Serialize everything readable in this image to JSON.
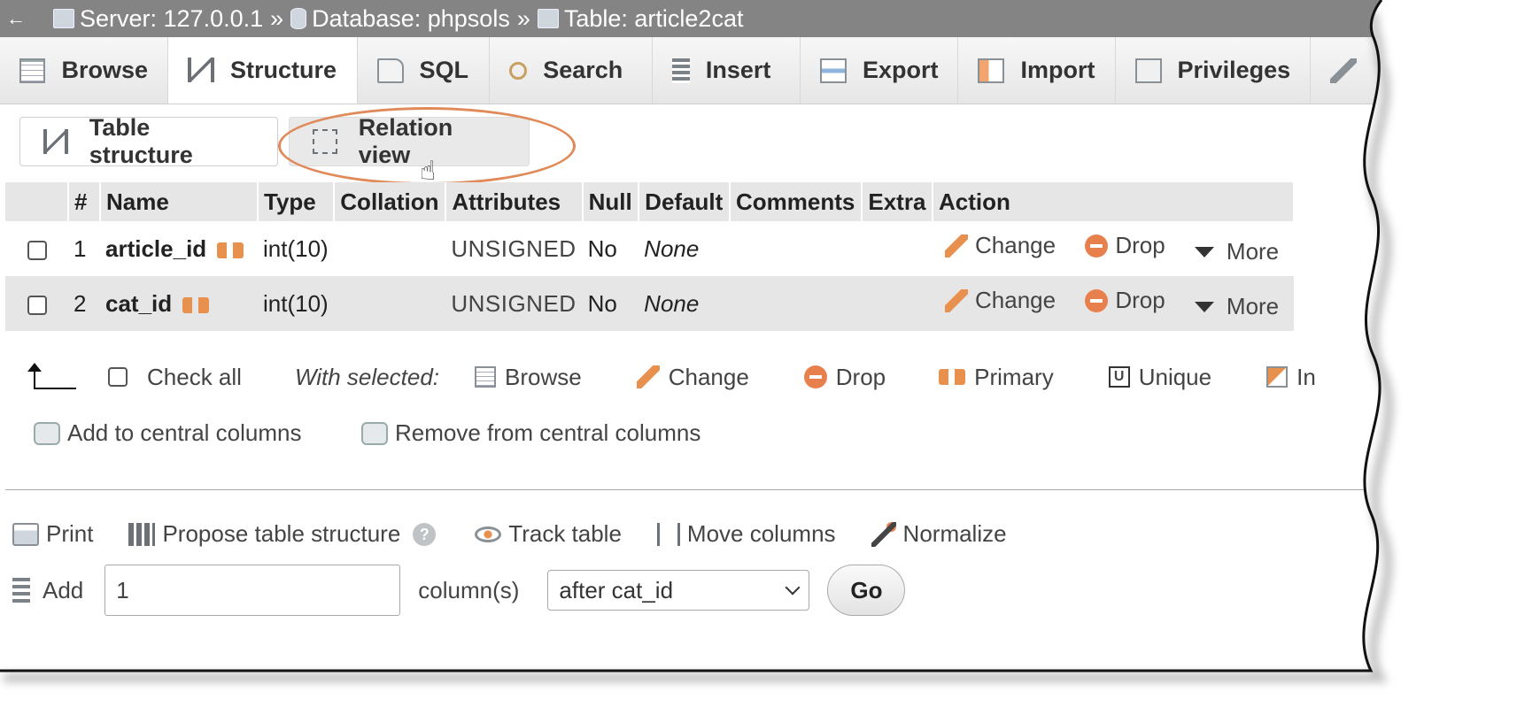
{
  "breadcrumb": {
    "back_glyph": "←",
    "server": "Server: 127.0.0.1",
    "database": "Database: phpsols",
    "table": "Table: article2cat",
    "separator": "»"
  },
  "tabs": [
    {
      "label": "Browse",
      "icon": "browse-icon"
    },
    {
      "label": "Structure",
      "icon": "structure-icon",
      "active": true
    },
    {
      "label": "SQL",
      "icon": "sql-icon"
    },
    {
      "label": "Search",
      "icon": "search-icon"
    },
    {
      "label": "Insert",
      "icon": "insert-icon"
    },
    {
      "label": "Export",
      "icon": "export-icon"
    },
    {
      "label": "Import",
      "icon": "import-icon"
    },
    {
      "label": "Privileges",
      "icon": "privileges-icon"
    }
  ],
  "subtabs": {
    "table_structure": "Table structure",
    "relation_view": "Relation view"
  },
  "table": {
    "headers": [
      "#",
      "Name",
      "Type",
      "Collation",
      "Attributes",
      "Null",
      "Default",
      "Comments",
      "Extra",
      "Action"
    ],
    "rows": [
      {
        "num": "1",
        "name": "article_id",
        "type": "int(10)",
        "attributes": "UNSIGNED",
        "null": "No",
        "default": "None"
      },
      {
        "num": "2",
        "name": "cat_id",
        "type": "int(10)",
        "attributes": "UNSIGNED",
        "null": "No",
        "default": "None"
      }
    ],
    "actions": {
      "change": "Change",
      "drop": "Drop",
      "more": "More"
    }
  },
  "bulk": {
    "check_all": "Check all",
    "with_selected": "With selected:",
    "browse": "Browse",
    "change": "Change",
    "drop": "Drop",
    "primary": "Primary",
    "unique": "Unique",
    "index_partial": "In",
    "add_central": "Add to central columns",
    "remove_central": "Remove from central columns"
  },
  "links": {
    "print": "Print",
    "propose": "Propose table structure",
    "help_glyph": "?",
    "track": "Track table",
    "move": "Move columns",
    "normalize": "Normalize"
  },
  "add_columns": {
    "label": "Add",
    "count": "1",
    "unit": "column(s)",
    "position": "after cat_id",
    "go": "Go"
  },
  "colors": {
    "breadcrumb_bg": "#848484",
    "highlight": "#e08a5a",
    "icon_orange": "#e8904e"
  }
}
